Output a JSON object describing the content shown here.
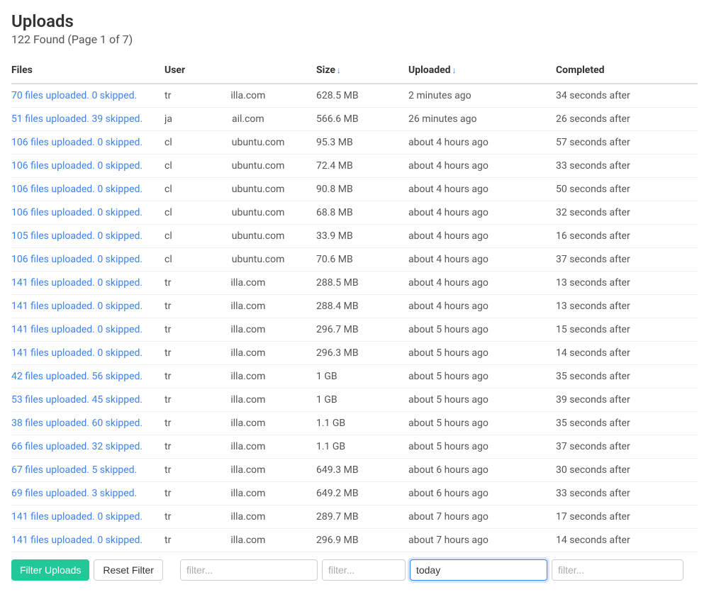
{
  "header": {
    "title": "Uploads",
    "subtitle": "122 Found (Page 1 of 7)"
  },
  "columns": {
    "files": "Files",
    "user": "User",
    "size": "Size",
    "uploaded": "Uploaded",
    "completed": "Completed"
  },
  "sort_indicator": "↓",
  "rows": [
    {
      "files": "70 files uploaded. 0 skipped.",
      "user_prefix": "tr",
      "user_suffix": "illa.com",
      "size": "628.5 MB",
      "uploaded": "2 minutes ago",
      "completed": "34 seconds after"
    },
    {
      "files": "51 files uploaded. 39 skipped.",
      "user_prefix": "ja",
      "user_suffix": "ail.com",
      "size": "566.6 MB",
      "uploaded": "26 minutes ago",
      "completed": "26 seconds after"
    },
    {
      "files": "106 files uploaded. 0 skipped.",
      "user_prefix": "cl",
      "user_suffix": "ubuntu.com",
      "size": "95.3 MB",
      "uploaded": "about 4 hours ago",
      "completed": "57 seconds after"
    },
    {
      "files": "106 files uploaded. 0 skipped.",
      "user_prefix": "cl",
      "user_suffix": "ubuntu.com",
      "size": "72.4 MB",
      "uploaded": "about 4 hours ago",
      "completed": "33 seconds after"
    },
    {
      "files": "106 files uploaded. 0 skipped.",
      "user_prefix": "cl",
      "user_suffix": "ubuntu.com",
      "size": "90.8 MB",
      "uploaded": "about 4 hours ago",
      "completed": "50 seconds after"
    },
    {
      "files": "106 files uploaded. 0 skipped.",
      "user_prefix": "cl",
      "user_suffix": "ubuntu.com",
      "size": "68.8 MB",
      "uploaded": "about 4 hours ago",
      "completed": "32 seconds after"
    },
    {
      "files": "105 files uploaded. 0 skipped.",
      "user_prefix": "cl",
      "user_suffix": "ubuntu.com",
      "size": "33.9 MB",
      "uploaded": "about 4 hours ago",
      "completed": "16 seconds after"
    },
    {
      "files": "106 files uploaded. 0 skipped.",
      "user_prefix": "cl",
      "user_suffix": "ubuntu.com",
      "size": "70.6 MB",
      "uploaded": "about 4 hours ago",
      "completed": "37 seconds after"
    },
    {
      "files": "141 files uploaded. 0 skipped.",
      "user_prefix": "tr",
      "user_suffix": "illa.com",
      "size": "288.5 MB",
      "uploaded": "about 4 hours ago",
      "completed": "13 seconds after"
    },
    {
      "files": "141 files uploaded. 0 skipped.",
      "user_prefix": "tr",
      "user_suffix": "illa.com",
      "size": "288.4 MB",
      "uploaded": "about 4 hours ago",
      "completed": "13 seconds after"
    },
    {
      "files": "141 files uploaded. 0 skipped.",
      "user_prefix": "tr",
      "user_suffix": "illa.com",
      "size": "296.7 MB",
      "uploaded": "about 5 hours ago",
      "completed": "15 seconds after"
    },
    {
      "files": "141 files uploaded. 0 skipped.",
      "user_prefix": "tr",
      "user_suffix": "illa.com",
      "size": "296.3 MB",
      "uploaded": "about 5 hours ago",
      "completed": "14 seconds after"
    },
    {
      "files": "42 files uploaded. 56 skipped.",
      "user_prefix": "tr",
      "user_suffix": "illa.com",
      "size": "1 GB",
      "uploaded": "about 5 hours ago",
      "completed": "35 seconds after"
    },
    {
      "files": "53 files uploaded. 45 skipped.",
      "user_prefix": "tr",
      "user_suffix": "illa.com",
      "size": "1 GB",
      "uploaded": "about 5 hours ago",
      "completed": "39 seconds after"
    },
    {
      "files": "38 files uploaded. 60 skipped.",
      "user_prefix": "tr",
      "user_suffix": "illa.com",
      "size": "1.1 GB",
      "uploaded": "about 5 hours ago",
      "completed": "35 seconds after"
    },
    {
      "files": "66 files uploaded. 32 skipped.",
      "user_prefix": "tr",
      "user_suffix": "illa.com",
      "size": "1.1 GB",
      "uploaded": "about 5 hours ago",
      "completed": "37 seconds after"
    },
    {
      "files": "67 files uploaded. 5 skipped.",
      "user_prefix": "tr",
      "user_suffix": "illa.com",
      "size": "649.3 MB",
      "uploaded": "about 6 hours ago",
      "completed": "30 seconds after"
    },
    {
      "files": "69 files uploaded. 3 skipped.",
      "user_prefix": "tr",
      "user_suffix": "illa.com",
      "size": "649.2 MB",
      "uploaded": "about 6 hours ago",
      "completed": "33 seconds after"
    },
    {
      "files": "141 files uploaded. 0 skipped.",
      "user_prefix": "tr",
      "user_suffix": "illa.com",
      "size": "289.7 MB",
      "uploaded": "about 7 hours ago",
      "completed": "17 seconds after"
    },
    {
      "files": "141 files uploaded. 0 skipped.",
      "user_prefix": "tr",
      "user_suffix": "illa.com",
      "size": "296.9 MB",
      "uploaded": "about 7 hours ago",
      "completed": "14 seconds after"
    }
  ],
  "filters": {
    "apply_label": "Filter Uploads",
    "reset_label": "Reset Filter",
    "placeholder": "filter...",
    "user_value": "",
    "size_value": "",
    "uploaded_value": "today",
    "completed_value": ""
  }
}
